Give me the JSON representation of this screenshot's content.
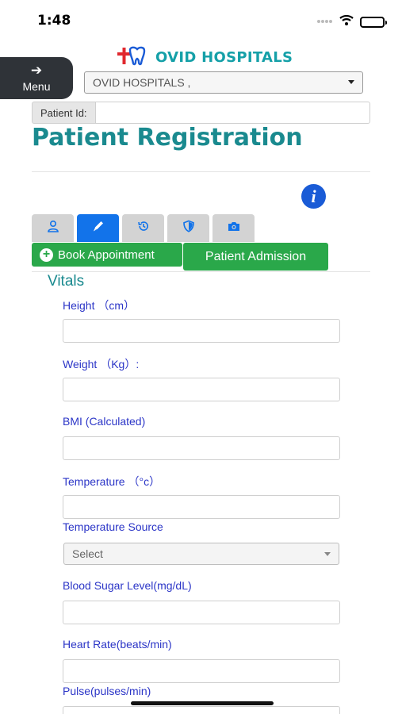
{
  "status": {
    "time": "1:48"
  },
  "header": {
    "logo_text": "OVID HOSPITALS",
    "menu_label": "Menu",
    "hospital_select_value": "OVID HOSPITALS ,"
  },
  "patient": {
    "id_label": "Patient Id:",
    "id_value": ""
  },
  "page_title": "Patient Registration",
  "tabs": [
    {
      "icon": "person-icon",
      "active": false
    },
    {
      "icon": "pencil-icon",
      "active": true
    },
    {
      "icon": "history-icon",
      "active": false
    },
    {
      "icon": "shield-icon",
      "active": false
    },
    {
      "icon": "camera-icon",
      "active": false
    }
  ],
  "actions": {
    "book_appointment": "Book Appointment",
    "patient_admission": "Patient Admission"
  },
  "vitals": {
    "title": "Vitals",
    "fields": {
      "height": "Height （cm）",
      "weight": "Weight （Kg）:",
      "bmi": "BMI (Calculated)",
      "temperature": "Temperature （°c）",
      "temperature_source": "Temperature Source",
      "temperature_source_value": "Select",
      "blood_sugar": "Blood Sugar Level(mg/dL)",
      "heart_rate": "Heart Rate(beats/min)",
      "pulse": "Pulse(pulses/min)"
    }
  },
  "colors": {
    "brand": "#1a8a8f",
    "primary": "#1273ea",
    "success": "#2aa84a",
    "label": "#2b35c7",
    "menu_bg": "#2f3338"
  }
}
